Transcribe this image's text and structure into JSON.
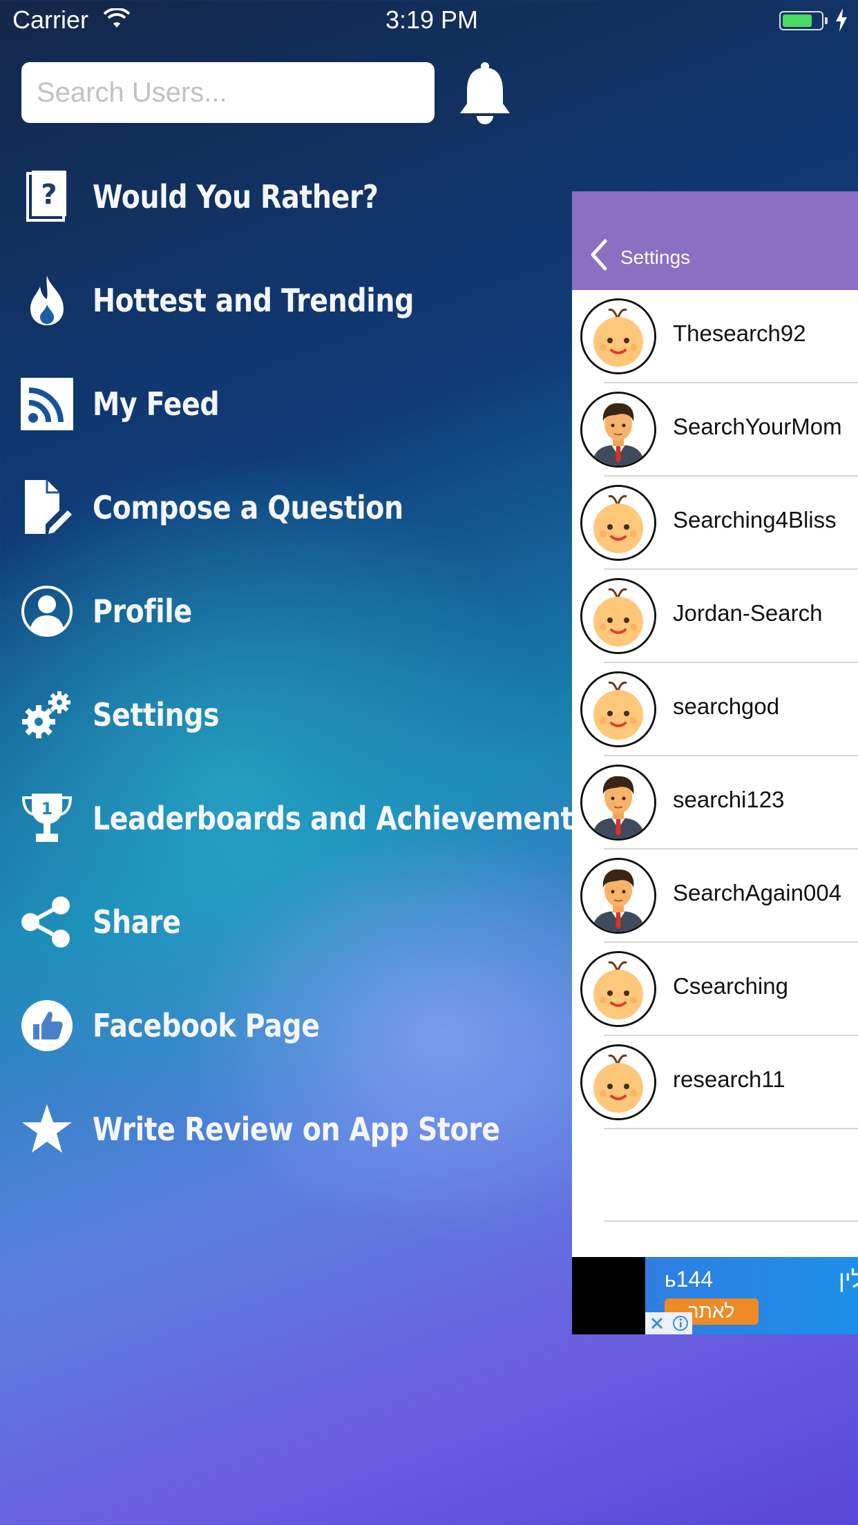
{
  "status": {
    "carrier": "Carrier",
    "time": "3:19 PM"
  },
  "search": {
    "placeholder": "Search Users..."
  },
  "menu": [
    {
      "label": "Would You Rather?",
      "icon": "question-book-icon"
    },
    {
      "label": "Hottest and Trending",
      "icon": "flame-icon"
    },
    {
      "label": "My Feed",
      "icon": "rss-icon"
    },
    {
      "label": "Compose a Question",
      "icon": "compose-icon"
    },
    {
      "label": "Profile",
      "icon": "profile-icon"
    },
    {
      "label": "Settings",
      "icon": "gears-icon"
    },
    {
      "label": "Leaderboards and Achievements",
      "icon": "trophy-icon"
    },
    {
      "label": "Share",
      "icon": "share-icon"
    },
    {
      "label": "Facebook Page",
      "icon": "thumbs-up-icon"
    },
    {
      "label": "Write Review on App Store",
      "icon": "star-icon"
    }
  ],
  "panel": {
    "back_label": "Settings",
    "header_color": "#8a6fc2",
    "users": [
      {
        "name": "Thesearch92",
        "avatar": "baby"
      },
      {
        "name": "SearchYourMom",
        "avatar": "man"
      },
      {
        "name": "Searching4Bliss",
        "avatar": "baby"
      },
      {
        "name": "Jordan-Search",
        "avatar": "baby"
      },
      {
        "name": "searchgod",
        "avatar": "baby"
      },
      {
        "name": "searchi123",
        "avatar": "man"
      },
      {
        "name": "SearchAgain004",
        "avatar": "man"
      },
      {
        "name": "Csearching",
        "avatar": "baby"
      },
      {
        "name": "research11",
        "avatar": "baby"
      }
    ]
  },
  "ad": {
    "text1": "ь144",
    "text2": "לין",
    "button": "לאתר"
  }
}
